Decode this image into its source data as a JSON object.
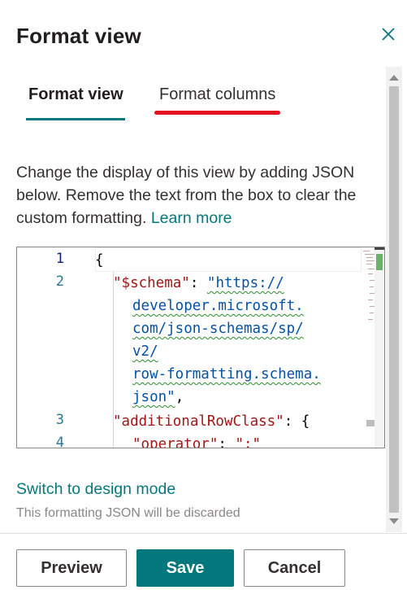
{
  "header": {
    "title": "Format view",
    "close_icon": "close-icon"
  },
  "tabs": [
    {
      "label": "Format view",
      "selected": true
    },
    {
      "label": "Format columns",
      "selected": false
    }
  ],
  "description": {
    "text": "Change the display of this view by adding JSON below. Remove the text from the box to clear the custom formatting. ",
    "link": "Learn more"
  },
  "editor": {
    "line_numbers": [
      "1",
      "2",
      "3",
      "4"
    ],
    "lines": [
      {
        "brace": "{"
      },
      {
        "key": "\"$schema\"",
        "colon": ": ",
        "value_parts": [
          "\"https://",
          "developer.microsoft.",
          "com/json-schemas/sp/",
          "v2/",
          "row-formatting.schema.",
          "json\""
        ],
        "tail": ","
      },
      {
        "key": "\"additionalRowClass\"",
        "colon": ": ",
        "tail": "{"
      },
      {
        "key": "\"operator\"",
        "colon": ": ",
        "value": "\":\""
      }
    ]
  },
  "design_mode": {
    "link": "Switch to design mode",
    "note": "This formatting JSON will be discarded"
  },
  "footer": {
    "preview": "Preview",
    "save": "Save",
    "cancel": "Cancel"
  },
  "colors": {
    "accent": "#03787c",
    "highlight": "#e3141f"
  }
}
